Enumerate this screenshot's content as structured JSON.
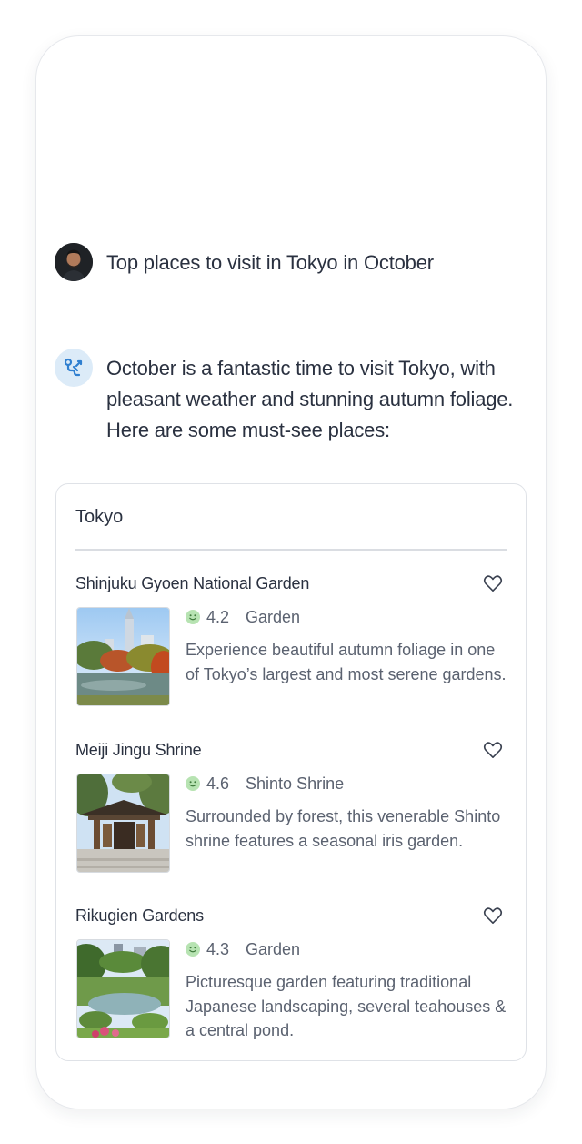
{
  "conversation": {
    "user_message": "Top places to visit in Tokyo in October",
    "assistant_message": "October is a fantastic time to visit Tokyo, with pleasant weather and stunning autumn foliage. Here are some must-see places:"
  },
  "card": {
    "title": "Tokyo",
    "places": [
      {
        "name": "Shinjuku Gyoen National Garden",
        "rating": "4.2",
        "category": "Garden",
        "description": "Experience beautiful autumn foliage in one of Tokyo’s largest and most serene gardens.",
        "icon": "heart-outline-icon"
      },
      {
        "name": "Meiji Jingu Shrine",
        "rating": "4.6",
        "category": "Shinto Shrine",
        "description": "Surrounded by forest, this venerable Shinto shrine features a seasonal iris garden.",
        "icon": "heart-outline-icon"
      },
      {
        "name": "Rikugien Gardens",
        "rating": "4.3",
        "category": "Garden",
        "description": "Picturesque garden featuring traditional Japanese landscaping, several teahouses & a central pond.",
        "icon": "heart-outline-icon"
      }
    ]
  },
  "colors": {
    "text_primary": "#2a3140",
    "text_secondary": "#5b6270",
    "rating_green": "#7cc77a",
    "assistant_avatar_bg": "#dcebf8",
    "assistant_avatar_icon": "#2f7fd0"
  }
}
